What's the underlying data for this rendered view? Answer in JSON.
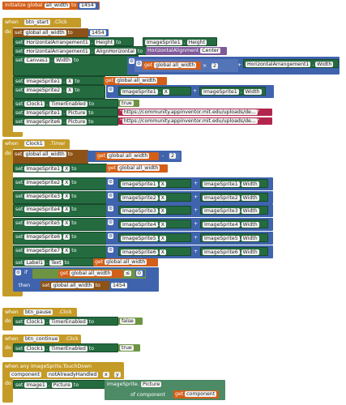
{
  "init": {
    "label": "initialize global",
    "var": "all_width",
    "to": "to",
    "value": "1454"
  },
  "kw": {
    "when": "when",
    "do": "do",
    "set": "set",
    "to": "to",
    "get": "get",
    "then": "then",
    "of_component": "of component"
  },
  "btn_start": {
    "component": "btn_start",
    "event": ".Click",
    "lines": {
      "l1": {
        "var": "global all_width",
        "val": "1454"
      },
      "l2": {
        "comp": "HorizontalArrangement1",
        "prop": "Height",
        "val_comp": "ImageSprite1",
        "val_prop": "Height"
      },
      "l3": {
        "comp": "HorizontalArrangement1",
        "prop": "AlignHorizontal",
        "val_label": "HorizontalAlignment",
        "val_opt": "Center"
      },
      "l4": {
        "comp": "Canvas1",
        "prop": "Width",
        "var": "global all_width",
        "op": "×",
        "num": "2",
        "plus": "+",
        "r_comp": "HorizontalArrangement1",
        "r_prop": "Width"
      },
      "l5": {
        "comp": "ImageSprite1",
        "prop": "X",
        "var": "global all_width"
      },
      "l6": {
        "comp": "ImageSprite2",
        "prop": "X",
        "a_comp": "ImageSprite1",
        "a_prop": "X",
        "plus": "+",
        "b_comp": "ImageSprite1",
        "b_prop": "Width"
      },
      "l7": {
        "comp": "Clock1",
        "prop": "TimerEnabled",
        "val": "true"
      },
      "l8": {
        "comp": "ImageSprite1",
        "prop": "Picture",
        "val": "https://community.appinventor.mit.edu/uploads/de..."
      },
      "l9": {
        "comp": "ImageSprite6",
        "prop": "Picture",
        "val": "https://community.appinventor.mit.edu/uploads/de..."
      }
    }
  },
  "timer": {
    "component": "Clock1",
    "event": ".Timer",
    "set_var": "global all_width",
    "get_var": "global all_width",
    "op": "-",
    "num": "2",
    "sprites": [
      {
        "comp": "ImageSprite1",
        "prop": "X",
        "var": "global all_width"
      },
      {
        "comp": "ImageSprite2",
        "prop": "X",
        "a": "ImageSprite1",
        "b": "ImageSprite1"
      },
      {
        "comp": "ImageSprite3",
        "prop": "X",
        "a": "ImageSprite2",
        "b": "ImageSprite2"
      },
      {
        "comp": "ImageSprite4",
        "prop": "X",
        "a": "ImageSprite3",
        "b": "ImageSprite3"
      },
      {
        "comp": "ImageSprite5",
        "prop": "X",
        "a": "ImageSprite4",
        "b": "ImageSprite4"
      },
      {
        "comp": "ImageSprite6",
        "prop": "X",
        "a": "ImageSprite5",
        "b": "ImageSprite5"
      },
      {
        "comp": "ImageSprite7",
        "prop": "X",
        "a": "ImageSprite6",
        "b": "ImageSprite6"
      }
    ],
    "a_prop": "X",
    "b_prop": "Width",
    "plus": "+",
    "label": {
      "comp": "Label1",
      "prop": "Text",
      "var": "global all_width"
    },
    "if": {
      "kw": "if",
      "var": "global all_width",
      "op": "≤",
      "num": "0"
    },
    "then": {
      "var": "global all_width",
      "val": "1454"
    }
  },
  "pause": {
    "component": "btn_pause",
    "event": ".Click",
    "comp": "Clock1",
    "prop": "TimerEnabled",
    "val": "false"
  },
  "cont": {
    "component": "btn_continue",
    "event": ".Click",
    "comp": "Clock1",
    "prop": "TimerEnabled",
    "val": "true"
  },
  "touch": {
    "title": "when any ImageSprite.TouchDown",
    "p1": "component",
    "p2": "notAlreadyHandled",
    "p3": "x",
    "p4": "y",
    "comp": "Image1",
    "prop": "Picture",
    "val_label": "ImageSprite.",
    "val_opt": "Picture",
    "of_label": "of component",
    "get_var": "component"
  },
  "colors": {
    "event": "#c59b27",
    "setter": "#256b40",
    "variable": "#d35f18",
    "math": "#3f64ad",
    "logic": "#6e9443",
    "text": "#b2264d"
  }
}
